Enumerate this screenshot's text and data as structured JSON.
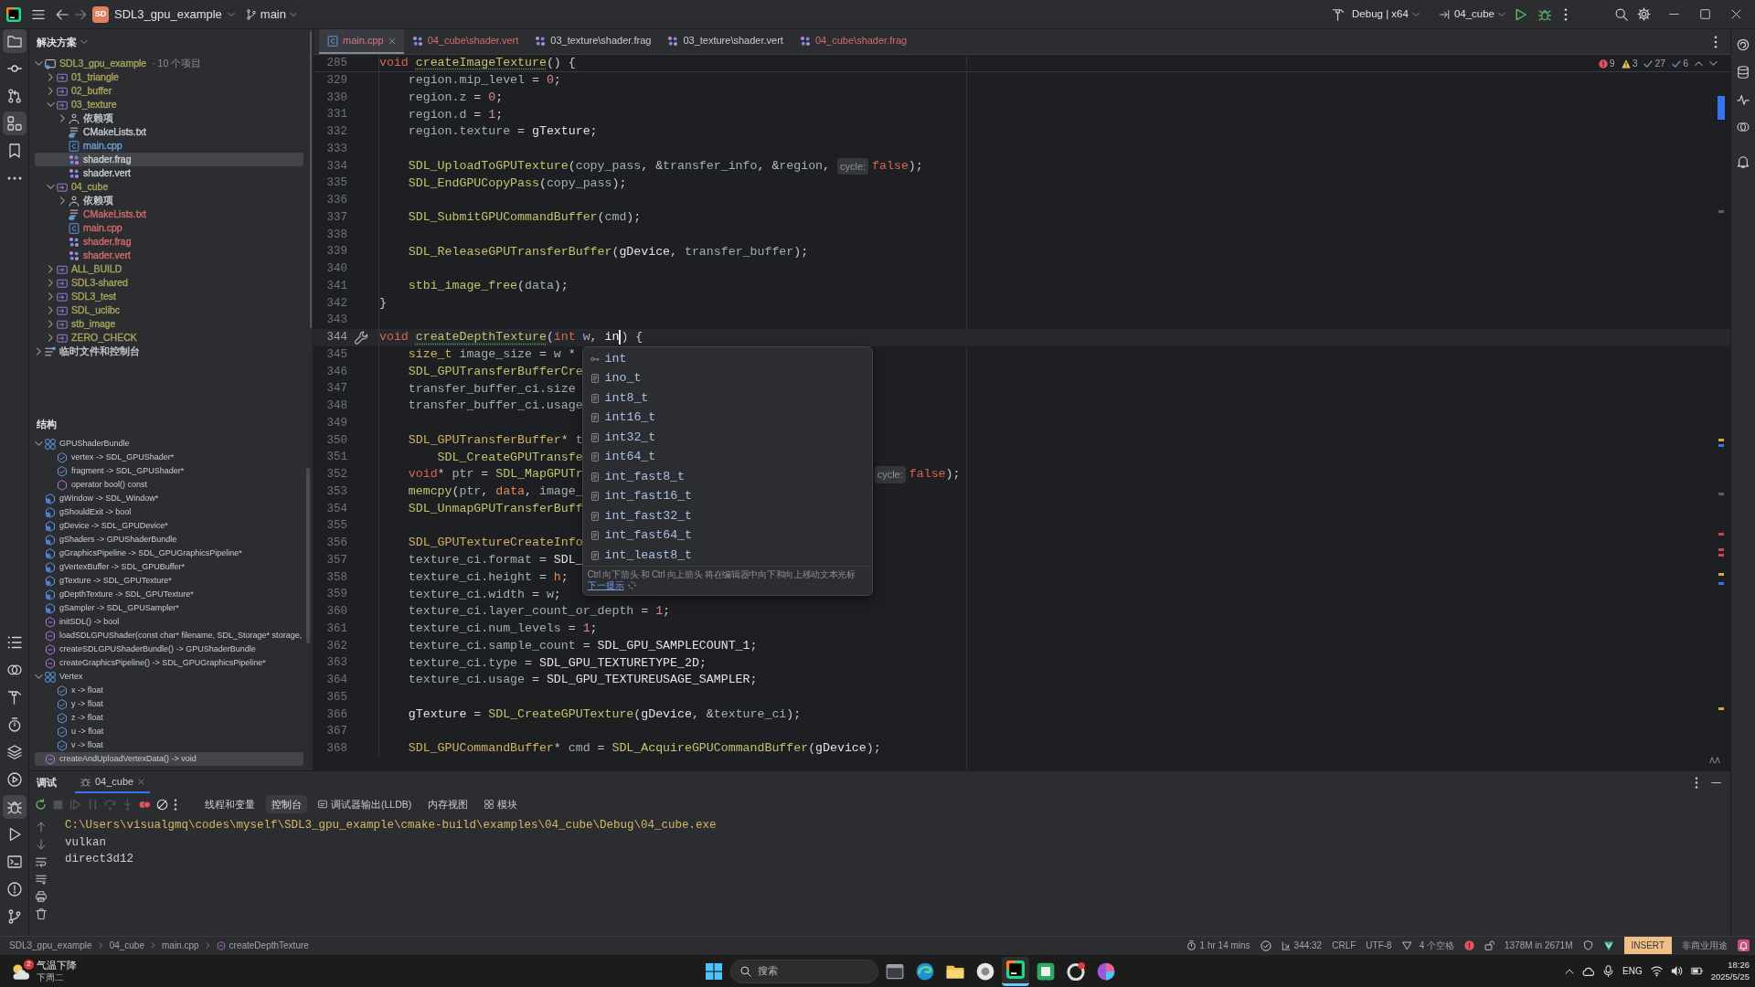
{
  "title_bar": {
    "project_badge": "SD",
    "project": "SDL3_gpu_example",
    "branch": "main",
    "build_config": "Debug | x64",
    "run_target": "04_cube"
  },
  "tool_strip": {
    "top": [
      {
        "kind": "project",
        "selected": true
      },
      {
        "kind": "commit",
        "selected": false
      },
      {
        "kind": "pull_requests",
        "selected": false
      },
      {
        "kind": "structure",
        "selected": true
      },
      {
        "kind": "bookmarks",
        "selected": false
      },
      {
        "kind": "more",
        "selected": false
      }
    ],
    "bottom": [
      {
        "kind": "todo",
        "selected": false
      },
      {
        "kind": "services",
        "selected": false
      },
      {
        "kind": "build",
        "selected": false
      },
      {
        "kind": "profiler",
        "selected": false
      },
      {
        "kind": "layers",
        "selected": false
      },
      {
        "kind": "run_dashboard",
        "selected": false
      },
      {
        "kind": "debug",
        "selected": true
      },
      {
        "kind": "run",
        "selected": false
      },
      {
        "kind": "terminal",
        "selected": false
      },
      {
        "kind": "problems",
        "selected": false
      },
      {
        "kind": "vcs",
        "selected": false
      }
    ]
  },
  "project_panel": {
    "title": "解决方案",
    "tree": [
      {
        "label": "SDL3_gpu_example",
        "note": "· 10 个项目",
        "kind": "solution",
        "color": "#a9a55c",
        "expanded": true,
        "selected": false,
        "children": [
          {
            "label": "01_triangle",
            "kind": "module",
            "color": "#a9a55c",
            "expanded": false,
            "selected": false
          },
          {
            "label": "02_buffer",
            "kind": "module",
            "color": "#a9a55c",
            "expanded": false,
            "selected": false
          },
          {
            "label": "03_texture",
            "kind": "module",
            "color": "#a9a55c",
            "expanded": true,
            "selected": false,
            "children": [
              {
                "label": "依赖项",
                "kind": "deps",
                "color": "#c9ccd1",
                "expanded": false,
                "selected": false
              },
              {
                "label": "CMakeLists.txt",
                "kind": "cmake",
                "color": "#c9ccd1",
                "selected": false
              },
              {
                "label": "main.cpp",
                "kind": "cpp",
                "color": "#6f9fd8",
                "selected": false
              },
              {
                "label": "shader.frag",
                "kind": "shader",
                "color": "#c9ccd1",
                "selected": true
              },
              {
                "label": "shader.vert",
                "kind": "shader",
                "color": "#c9ccd1",
                "selected": false
              }
            ]
          },
          {
            "label": "04_cube",
            "kind": "module",
            "color": "#a9a55c",
            "expanded": true,
            "selected": false,
            "children": [
              {
                "label": "依赖项",
                "kind": "deps",
                "color": "#c9ccd1",
                "expanded": false,
                "selected": false
              },
              {
                "label": "CMakeLists.txt",
                "kind": "cmake",
                "color": "#d36b6b",
                "selected": false
              },
              {
                "label": "main.cpp",
                "kind": "cpp",
                "color": "#d36b6b",
                "selected": false
              },
              {
                "label": "shader.frag",
                "kind": "shader",
                "color": "#d36b6b",
                "selected": false
              },
              {
                "label": "shader.vert",
                "kind": "shader",
                "color": "#d36b6b",
                "selected": false
              }
            ]
          },
          {
            "label": "ALL_BUILD",
            "kind": "module",
            "color": "#a9a55c",
            "expanded": false,
            "selected": false
          },
          {
            "label": "SDL3-shared",
            "kind": "module",
            "color": "#a9a55c",
            "expanded": false,
            "selected": false
          },
          {
            "label": "SDL3_test",
            "kind": "module",
            "color": "#a9a55c",
            "expanded": false,
            "selected": false
          },
          {
            "label": "SDL_uclibc",
            "kind": "module",
            "color": "#a9a55c",
            "expanded": false,
            "selected": false
          },
          {
            "label": "stb_image",
            "kind": "module",
            "color": "#a9a55c",
            "expanded": false,
            "selected": false
          },
          {
            "label": "ZERO_CHECK",
            "kind": "module",
            "color": "#a9a55c",
            "expanded": false,
            "selected": false
          }
        ]
      },
      {
        "label": "临时文件和控制台",
        "kind": "scratches",
        "color": "#c9ccd1",
        "expanded": false,
        "selected": false
      }
    ]
  },
  "structure_panel": {
    "title": "结构",
    "items": [
      {
        "label": "GPUShaderBundle",
        "kind": "struct",
        "expanded": true,
        "selected": false,
        "children": [
          {
            "label": "vertex -> SDL_GPUShader*",
            "kind": "field",
            "selected": false
          },
          {
            "label": "fragment -> SDL_GPUShader*",
            "kind": "field",
            "selected": false
          },
          {
            "label": "operator bool() const",
            "kind": "method",
            "selected": false
          }
        ]
      },
      {
        "label": "gWindow -> SDL_Window*",
        "kind": "global",
        "selected": false
      },
      {
        "label": "gShouldExit -> bool",
        "kind": "global",
        "selected": false
      },
      {
        "label": "gDevice -> SDL_GPUDevice*",
        "kind": "global",
        "selected": false
      },
      {
        "label": "gShaders -> GPUShaderBundle",
        "kind": "global",
        "selected": false
      },
      {
        "label": "gGraphicsPipeline -> SDL_GPUGraphicsPipeline*",
        "kind": "global",
        "selected": false
      },
      {
        "label": "gVertexBuffer -> SDL_GPUBuffer*",
        "kind": "global",
        "selected": false
      },
      {
        "label": "gTexture -> SDL_GPUTexture*",
        "kind": "global",
        "selected": false
      },
      {
        "label": "gDepthTexture -> SDL_GPUTexture*",
        "kind": "global",
        "selected": false
      },
      {
        "label": "gSampler -> SDL_GPUSampler*",
        "kind": "global",
        "selected": false
      },
      {
        "label": "initSDL() -> bool",
        "kind": "function",
        "selected": false
      },
      {
        "label": "loadSDLGPUShader(const char* filename, SDL_Storage* storage,",
        "kind": "function",
        "selected": false
      },
      {
        "label": "createSDLGPUShaderBundle() -> GPUShaderBundle",
        "kind": "function",
        "selected": false
      },
      {
        "label": "createGraphicsPipeline() -> SDL_GPUGraphicsPipeline*",
        "kind": "function",
        "selected": false
      },
      {
        "label": "Vertex",
        "kind": "struct",
        "expanded": true,
        "selected": false,
        "children": [
          {
            "label": "x -> float",
            "kind": "field",
            "selected": false
          },
          {
            "label": "y -> float",
            "kind": "field",
            "selected": false
          },
          {
            "label": "z -> float",
            "kind": "field",
            "selected": false
          },
          {
            "label": "u -> float",
            "kind": "field",
            "selected": false
          },
          {
            "label": "v -> float",
            "kind": "field",
            "selected": false
          }
        ]
      },
      {
        "label": "createAndUploadVertexData() -> void",
        "kind": "function",
        "selected": true
      }
    ]
  },
  "editor_tabs": [
    {
      "label": "main.cpp",
      "kind": "cpp",
      "selected": true,
      "color": "#d07a8a"
    },
    {
      "label": "04_cube\\shader.vert",
      "kind": "shader",
      "selected": false,
      "color": "#d36b6b"
    },
    {
      "label": "03_texture\\shader.frag",
      "kind": "shader",
      "selected": false,
      "color": "#c9ccd1"
    },
    {
      "label": "03_texture\\shader.vert",
      "kind": "shader",
      "selected": false,
      "color": "#c9ccd1"
    },
    {
      "label": "04_cube\\shader.frag",
      "kind": "shader",
      "selected": false,
      "color": "#d36b6b"
    }
  ],
  "editor": {
    "inspections": [
      {
        "kind": "error",
        "count": "9"
      },
      {
        "kind": "warning",
        "count": "3"
      },
      {
        "kind": "weak_warning",
        "count": "27"
      },
      {
        "kind": "typo",
        "count": "6"
      }
    ],
    "sticky_line": {
      "number": "285",
      "tokens": [
        {
          "text": "void ",
          "kind": "keyword"
        },
        {
          "text": "createImageTexture",
          "kind": "declaration"
        },
        {
          "text": "() {",
          "kind": "plain"
        }
      ]
    },
    "lines": [
      {
        "number": "329",
        "current": false,
        "tokens": [
          {
            "text": "    region.mip_level",
            "kind": "variable"
          },
          {
            "text": " = ",
            "kind": "plain"
          },
          {
            "text": "0",
            "kind": "number"
          },
          {
            "text": ";",
            "kind": "plain"
          }
        ]
      },
      {
        "number": "330",
        "current": false,
        "tokens": [
          {
            "text": "    region.z",
            "kind": "variable"
          },
          {
            "text": " = ",
            "kind": "plain"
          },
          {
            "text": "0",
            "kind": "number"
          },
          {
            "text": ";",
            "kind": "plain"
          }
        ]
      },
      {
        "number": "331",
        "current": false,
        "tokens": [
          {
            "text": "    region.d",
            "kind": "variable"
          },
          {
            "text": " = ",
            "kind": "plain"
          },
          {
            "text": "1",
            "kind": "number"
          },
          {
            "text": ";",
            "kind": "plain"
          }
        ]
      },
      {
        "number": "332",
        "current": false,
        "tokens": [
          {
            "text": "    region.texture",
            "kind": "variable"
          },
          {
            "text": " = ",
            "kind": "plain"
          },
          {
            "text": "gTexture",
            "kind": "global"
          },
          {
            "text": ";",
            "kind": "plain"
          }
        ]
      },
      {
        "number": "333",
        "current": false
      },
      {
        "number": "334",
        "current": false,
        "tokens": [
          {
            "text": "    SDL_UploadToGPUTexture",
            "kind": "function"
          },
          {
            "text": "(",
            "kind": "plain"
          },
          {
            "text": "copy_pass",
            "kind": "variable"
          },
          {
            "text": ", &",
            "kind": "plain"
          },
          {
            "text": "transfer_info",
            "kind": "variable"
          },
          {
            "text": ", &",
            "kind": "plain"
          },
          {
            "text": "region",
            "kind": "variable"
          },
          {
            "text": ", ",
            "kind": "plain"
          },
          {
            "text": "cycle:",
            "kind": "inlay"
          },
          {
            "text": "false",
            "kind": "keyword"
          },
          {
            "text": ");",
            "kind": "plain"
          }
        ]
      },
      {
        "number": "335",
        "current": false,
        "tokens": [
          {
            "text": "    SDL_EndGPUCopyPass",
            "kind": "function"
          },
          {
            "text": "(",
            "kind": "plain"
          },
          {
            "text": "copy_pass",
            "kind": "variable"
          },
          {
            "text": ");",
            "kind": "plain"
          }
        ]
      },
      {
        "number": "336",
        "current": false
      },
      {
        "number": "337",
        "current": false,
        "tokens": [
          {
            "text": "    SDL_SubmitGPUCommandBuffer",
            "kind": "function"
          },
          {
            "text": "(",
            "kind": "plain"
          },
          {
            "text": "cmd",
            "kind": "variable"
          },
          {
            "text": ");",
            "kind": "plain"
          }
        ]
      },
      {
        "number": "338",
        "current": false
      },
      {
        "number": "339",
        "current": false,
        "tokens": [
          {
            "text": "    SDL_ReleaseGPUTransferBuffer",
            "kind": "function"
          },
          {
            "text": "(",
            "kind": "plain"
          },
          {
            "text": "gDevice",
            "kind": "global"
          },
          {
            "text": ", ",
            "kind": "plain"
          },
          {
            "text": "transfer_buffer",
            "kind": "variable"
          },
          {
            "text": ");",
            "kind": "plain"
          }
        ]
      },
      {
        "number": "340",
        "current": false
      },
      {
        "number": "341",
        "current": false,
        "tokens": [
          {
            "text": "    stbi_image_free",
            "kind": "function"
          },
          {
            "text": "(",
            "kind": "plain"
          },
          {
            "text": "data",
            "kind": "variable"
          },
          {
            "text": ");",
            "kind": "plain"
          }
        ]
      },
      {
        "number": "342",
        "current": false,
        "tokens": [
          {
            "text": "}",
            "kind": "plain"
          }
        ]
      },
      {
        "number": "343",
        "current": false
      },
      {
        "number": "344",
        "current": true,
        "tokens": [
          {
            "text": "void ",
            "kind": "keyword"
          },
          {
            "text": "createDepthTexture",
            "kind": "declaration"
          },
          {
            "text": "(",
            "kind": "plain"
          },
          {
            "text": "int ",
            "kind": "keyword"
          },
          {
            "text": "w",
            "kind": "variable"
          },
          {
            "text": ", ",
            "kind": "plain"
          },
          {
            "text": "in",
            "kind": "typing"
          },
          {
            "kind": "caret"
          },
          {
            "text": ") {",
            "kind": "plain"
          }
        ]
      },
      {
        "number": "345",
        "current": false,
        "tokens": [
          {
            "text": "    size_t",
            "kind": "type"
          },
          {
            "text": " image_size",
            "kind": "variable"
          },
          {
            "text": " = ",
            "kind": "plain"
          },
          {
            "text": "w",
            "kind": "variable"
          },
          {
            "text": " *",
            "kind": "plain"
          }
        ]
      },
      {
        "number": "346",
        "current": false,
        "tokens": [
          {
            "text": "    SDL_GPUTransferBufferCre",
            "kind": "function"
          }
        ]
      },
      {
        "number": "347",
        "current": false,
        "tokens": [
          {
            "text": "    transfer_buffer_ci.size",
            "kind": "variable"
          }
        ]
      },
      {
        "number": "348",
        "current": false,
        "tokens": [
          {
            "text": "    transfer_buffer_ci.usage",
            "kind": "variable"
          }
        ]
      },
      {
        "number": "349",
        "current": false
      },
      {
        "number": "350",
        "current": false,
        "tokens": [
          {
            "text": "    SDL_GPUTransferBuffer",
            "kind": "type"
          },
          {
            "text": "* ",
            "kind": "plain"
          },
          {
            "text": "t",
            "kind": "variable"
          }
        ]
      },
      {
        "number": "351",
        "current": false,
        "tokens": [
          {
            "text": "        SDL_CreateGPUTransfe",
            "kind": "function"
          }
        ]
      },
      {
        "number": "352",
        "current": false,
        "tokens": [
          {
            "text": "    void",
            "kind": "keyword"
          },
          {
            "text": "* ",
            "kind": "plain"
          },
          {
            "text": "ptr",
            "kind": "variable"
          },
          {
            "text": " = ",
            "kind": "plain"
          },
          {
            "text": "SDL_MapGPUTr",
            "kind": "function"
          }
        ],
        "tail_tokens": [
          {
            "text": "cycle:",
            "kind": "inlay"
          },
          {
            "text": "false",
            "kind": "keyword"
          },
          {
            "text": ");",
            "kind": "plain"
          }
        ]
      },
      {
        "number": "353",
        "current": false,
        "tokens": [
          {
            "text": "    memcpy",
            "kind": "function"
          },
          {
            "text": "(",
            "kind": "plain"
          },
          {
            "text": "ptr",
            "kind": "variable"
          },
          {
            "text": ", ",
            "kind": "plain"
          },
          {
            "text": "data",
            "kind": "error"
          },
          {
            "text": ", ",
            "kind": "plain"
          },
          {
            "text": "image_",
            "kind": "variable"
          }
        ]
      },
      {
        "number": "354",
        "current": false,
        "tokens": [
          {
            "text": "    SDL_UnmapGPUTransferBuff",
            "kind": "function"
          }
        ]
      },
      {
        "number": "355",
        "current": false
      },
      {
        "number": "356",
        "current": false,
        "tokens": [
          {
            "text": "    SDL_GPUTextureCreateInfo",
            "kind": "type"
          }
        ]
      },
      {
        "number": "357",
        "current": false,
        "tokens": [
          {
            "text": "    texture_ci.format",
            "kind": "variable"
          },
          {
            "text": " = ",
            "kind": "plain"
          },
          {
            "text": "SDL_",
            "kind": "constant"
          }
        ]
      },
      {
        "number": "358",
        "current": false,
        "tokens": [
          {
            "text": "    texture_ci.height",
            "kind": "variable"
          },
          {
            "text": " = ",
            "kind": "plain"
          },
          {
            "text": "h",
            "kind": "error"
          },
          {
            "text": ";",
            "kind": "plain"
          }
        ]
      },
      {
        "number": "359",
        "current": false,
        "tokens": [
          {
            "text": "    texture_ci.width",
            "kind": "variable"
          },
          {
            "text": " = ",
            "kind": "plain"
          },
          {
            "text": "w",
            "kind": "variable"
          },
          {
            "text": ";",
            "kind": "plain"
          }
        ]
      },
      {
        "number": "360",
        "current": false,
        "tokens": [
          {
            "text": "    texture_ci.layer_count_or_depth",
            "kind": "variable"
          },
          {
            "text": " = ",
            "kind": "plain"
          },
          {
            "text": "1",
            "kind": "number"
          },
          {
            "text": ";",
            "kind": "plain"
          }
        ]
      },
      {
        "number": "361",
        "current": false,
        "tokens": [
          {
            "text": "    texture_ci.num_levels",
            "kind": "variable"
          },
          {
            "text": " = ",
            "kind": "plain"
          },
          {
            "text": "1",
            "kind": "number"
          },
          {
            "text": ";",
            "kind": "plain"
          }
        ]
      },
      {
        "number": "362",
        "current": false,
        "tokens": [
          {
            "text": "    texture_ci.sample_count",
            "kind": "variable"
          },
          {
            "text": " = ",
            "kind": "plain"
          },
          {
            "text": "SDL_GPU_SAMPLECOUNT_1",
            "kind": "constant"
          },
          {
            "text": ";",
            "kind": "plain"
          }
        ]
      },
      {
        "number": "363",
        "current": false,
        "tokens": [
          {
            "text": "    texture_ci.type",
            "kind": "variable"
          },
          {
            "text": " = ",
            "kind": "plain"
          },
          {
            "text": "SDL_GPU_TEXTURETYPE_2D",
            "kind": "constant"
          },
          {
            "text": ";",
            "kind": "plain"
          }
        ]
      },
      {
        "number": "364",
        "current": false,
        "tokens": [
          {
            "text": "    texture_ci.usage",
            "kind": "variable"
          },
          {
            "text": " = ",
            "kind": "plain"
          },
          {
            "text": "SDL_GPU_TEXTUREUSAGE_SAMPLER",
            "kind": "constant"
          },
          {
            "text": ";",
            "kind": "plain"
          }
        ]
      },
      {
        "number": "365",
        "current": false
      },
      {
        "number": "366",
        "current": false,
        "tokens": [
          {
            "text": "    gTexture",
            "kind": "global"
          },
          {
            "text": " = ",
            "kind": "plain"
          },
          {
            "text": "SDL_CreateGPUTexture",
            "kind": "function"
          },
          {
            "text": "(",
            "kind": "plain"
          },
          {
            "text": "gDevice",
            "kind": "global"
          },
          {
            "text": ", &",
            "kind": "plain"
          },
          {
            "text": "texture_ci",
            "kind": "variable"
          },
          {
            "text": ");",
            "kind": "plain"
          }
        ]
      },
      {
        "number": "367",
        "current": false
      },
      {
        "number": "368",
        "current": false,
        "tokens": [
          {
            "text": "    SDL_GPUCommandBuffer",
            "kind": "type"
          },
          {
            "text": "* ",
            "kind": "plain"
          },
          {
            "text": "cmd",
            "kind": "variable"
          },
          {
            "text": " = ",
            "kind": "plain"
          },
          {
            "text": "SDL_AcquireGPUCommandBuffer",
            "kind": "function"
          },
          {
            "text": "(",
            "kind": "plain"
          },
          {
            "text": "gDevice",
            "kind": "global"
          },
          {
            "text": ");",
            "kind": "plain"
          }
        ]
      }
    ]
  },
  "completion": {
    "items": [
      {
        "label": "int",
        "kind": "keyword"
      },
      {
        "label": "ino_t",
        "kind": "typedef"
      },
      {
        "label": "int8_t",
        "kind": "typedef"
      },
      {
        "label": "int16_t",
        "kind": "typedef"
      },
      {
        "label": "int32_t",
        "kind": "typedef"
      },
      {
        "label": "int64_t",
        "kind": "typedef"
      },
      {
        "label": "int_fast8_t",
        "kind": "typedef"
      },
      {
        "label": "int_fast16_t",
        "kind": "typedef"
      },
      {
        "label": "int_fast32_t",
        "kind": "typedef"
      },
      {
        "label": "int_fast64_t",
        "kind": "typedef"
      },
      {
        "label": "int_least8_t",
        "kind": "typedef"
      }
    ],
    "hint": "Ctrl 向下箭头 和 Ctrl 向上箭头 将在编辑器中向下和向上移动文本光标",
    "next_tip": "下一提示"
  },
  "debug_panel": {
    "title": "调试",
    "session": {
      "label": "04_cube",
      "selected": true
    },
    "toolbar": [
      {
        "kind": "rerun",
        "disabled": false
      },
      {
        "kind": "stop",
        "disabled": true
      },
      {
        "kind": "resume",
        "disabled": true
      },
      {
        "kind": "pause",
        "disabled": true
      },
      {
        "kind": "step_over",
        "disabled": true
      },
      {
        "kind": "step_into",
        "disabled": true
      },
      {
        "kind": "breakpoints",
        "disabled": false
      },
      {
        "kind": "mute_breakpoints",
        "disabled": false
      }
    ],
    "tabs": [
      {
        "label": "线程和变量",
        "kind": "plain",
        "selected": false
      },
      {
        "label": "控制台",
        "kind": "plain",
        "selected": true
      },
      {
        "label": "调试器输出(LLDB)",
        "kind": "output",
        "selected": false
      },
      {
        "label": "内存视图",
        "kind": "plain",
        "selected": false
      },
      {
        "label": "模块",
        "kind": "modules",
        "selected": false
      }
    ],
    "console": [
      {
        "text": "C:\\Users\\visualgmq\\codes\\myself\\SDL3_gpu_example\\cmake-build\\examples\\04_cube\\Debug\\04_cube.exe",
        "kind": "command"
      },
      {
        "text": "vulkan",
        "kind": "output"
      },
      {
        "text": "direct3d12",
        "kind": "output"
      }
    ]
  },
  "status_bar": {
    "breadcrumbs": [
      {
        "label": "SDL3_gpu_example",
        "kind": "plain"
      },
      {
        "label": "04_cube",
        "kind": "plain"
      },
      {
        "label": "main.cpp",
        "kind": "plain"
      },
      {
        "label": "createDepthTexture",
        "kind": "function"
      }
    ],
    "widgets": [
      {
        "kind": "timer",
        "text": "1 hr 14 mins"
      },
      {
        "kind": "check"
      },
      {
        "kind": "position",
        "text": "344:32"
      },
      {
        "kind": "plain",
        "text": "CRLF"
      },
      {
        "kind": "plain",
        "text": "UTF-8"
      },
      {
        "kind": "indent",
        "text": "4 个空格"
      },
      {
        "kind": "error_dot"
      },
      {
        "kind": "lock"
      },
      {
        "kind": "plain",
        "text": "1378M in 2671M"
      },
      {
        "kind": "shield"
      },
      {
        "kind": "vim"
      },
      {
        "kind": "mode",
        "text": "INSERT"
      },
      {
        "kind": "plain",
        "text": "非商业用途"
      },
      {
        "kind": "notifications"
      }
    ]
  },
  "taskbar": {
    "weather": {
      "badge": "2",
      "headline": "气温下降",
      "detail": "下周二"
    },
    "search": {
      "placeholder": "搜索"
    },
    "apps": [
      {
        "kind": "window",
        "selected": false
      },
      {
        "kind": "browser",
        "selected": false
      },
      {
        "kind": "files",
        "selected": false
      },
      {
        "kind": "circle",
        "selected": false
      },
      {
        "kind": "ide",
        "selected": true
      },
      {
        "kind": "green",
        "selected": false
      },
      {
        "kind": "badge",
        "selected": false
      },
      {
        "kind": "colors",
        "selected": false
      }
    ],
    "tray": {
      "language": "ENG",
      "time": "18:26",
      "date": "2025/5/25"
    }
  }
}
